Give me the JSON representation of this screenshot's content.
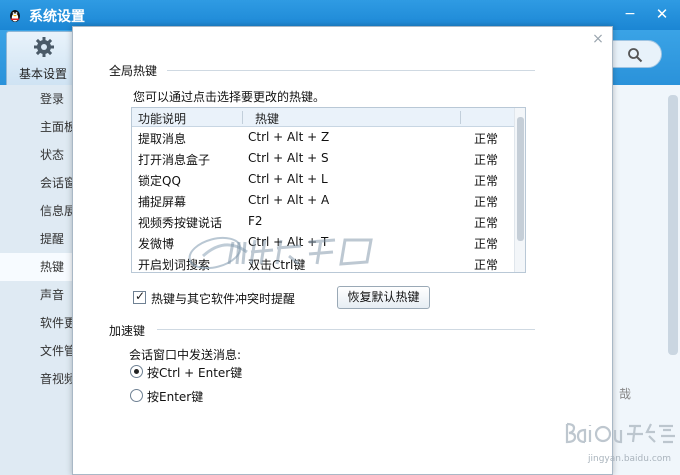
{
  "window": {
    "title": "系统设置",
    "minimize_glyph": "−",
    "close_glyph": "✕"
  },
  "toolbar": {
    "tab_basic_label": "基本设置"
  },
  "sidebar": {
    "items": [
      {
        "label": "登录"
      },
      {
        "label": "主面板"
      },
      {
        "label": "状态"
      },
      {
        "label": "会话窗口"
      },
      {
        "label": "信息展示"
      },
      {
        "label": "提醒"
      },
      {
        "label": "热键",
        "active": true
      },
      {
        "label": "声音"
      },
      {
        "label": "软件更新"
      },
      {
        "label": "文件管理"
      },
      {
        "label": "音视频"
      }
    ]
  },
  "background": {
    "fragment_text": "哉"
  },
  "dialog": {
    "close_glyph": "×",
    "global_hotkeys_title": "全局热键",
    "hint": "您可以通过点击选择要更改的热键。",
    "table": {
      "columns": [
        "功能说明",
        "热键",
        ""
      ],
      "rows": [
        {
          "func": "提取消息",
          "key": "Ctrl + Alt + Z",
          "status": "正常"
        },
        {
          "func": "打开消息盒子",
          "key": "Ctrl + Alt + S",
          "status": "正常"
        },
        {
          "func": "锁定QQ",
          "key": "Ctrl + Alt + L",
          "status": "正常"
        },
        {
          "func": "捕捉屏幕",
          "key": "Ctrl + Alt + A",
          "status": "正常"
        },
        {
          "func": "视频秀按键说话",
          "key": "F2",
          "status": "正常"
        },
        {
          "func": "发微博",
          "key": "Ctrl + Alt + T",
          "status": "正常"
        },
        {
          "func": "开启划词搜索",
          "key": "双击Ctrl键",
          "status": "正常"
        }
      ]
    },
    "conflict_checkbox": {
      "label": "热键与其它软件冲突时提醒",
      "checked": true,
      "mark": "✓"
    },
    "restore_button": "恢复默认热键",
    "accelerator_title": "加速键",
    "send_label": "会话窗口中发送消息:",
    "send_options": [
      {
        "label": "按Ctrl + Enter键",
        "selected": true
      },
      {
        "label": "按Enter键",
        "selected": false
      }
    ]
  },
  "watermarks": {
    "site_url": "jingyan.baidu.com"
  },
  "colors": {
    "titlebar": "#1b86d4",
    "toolbar": "#2a92da",
    "sidebar": "#dfeaf3",
    "dialog_bg": "#ffffff",
    "table_header": "#eaf2fa"
  }
}
